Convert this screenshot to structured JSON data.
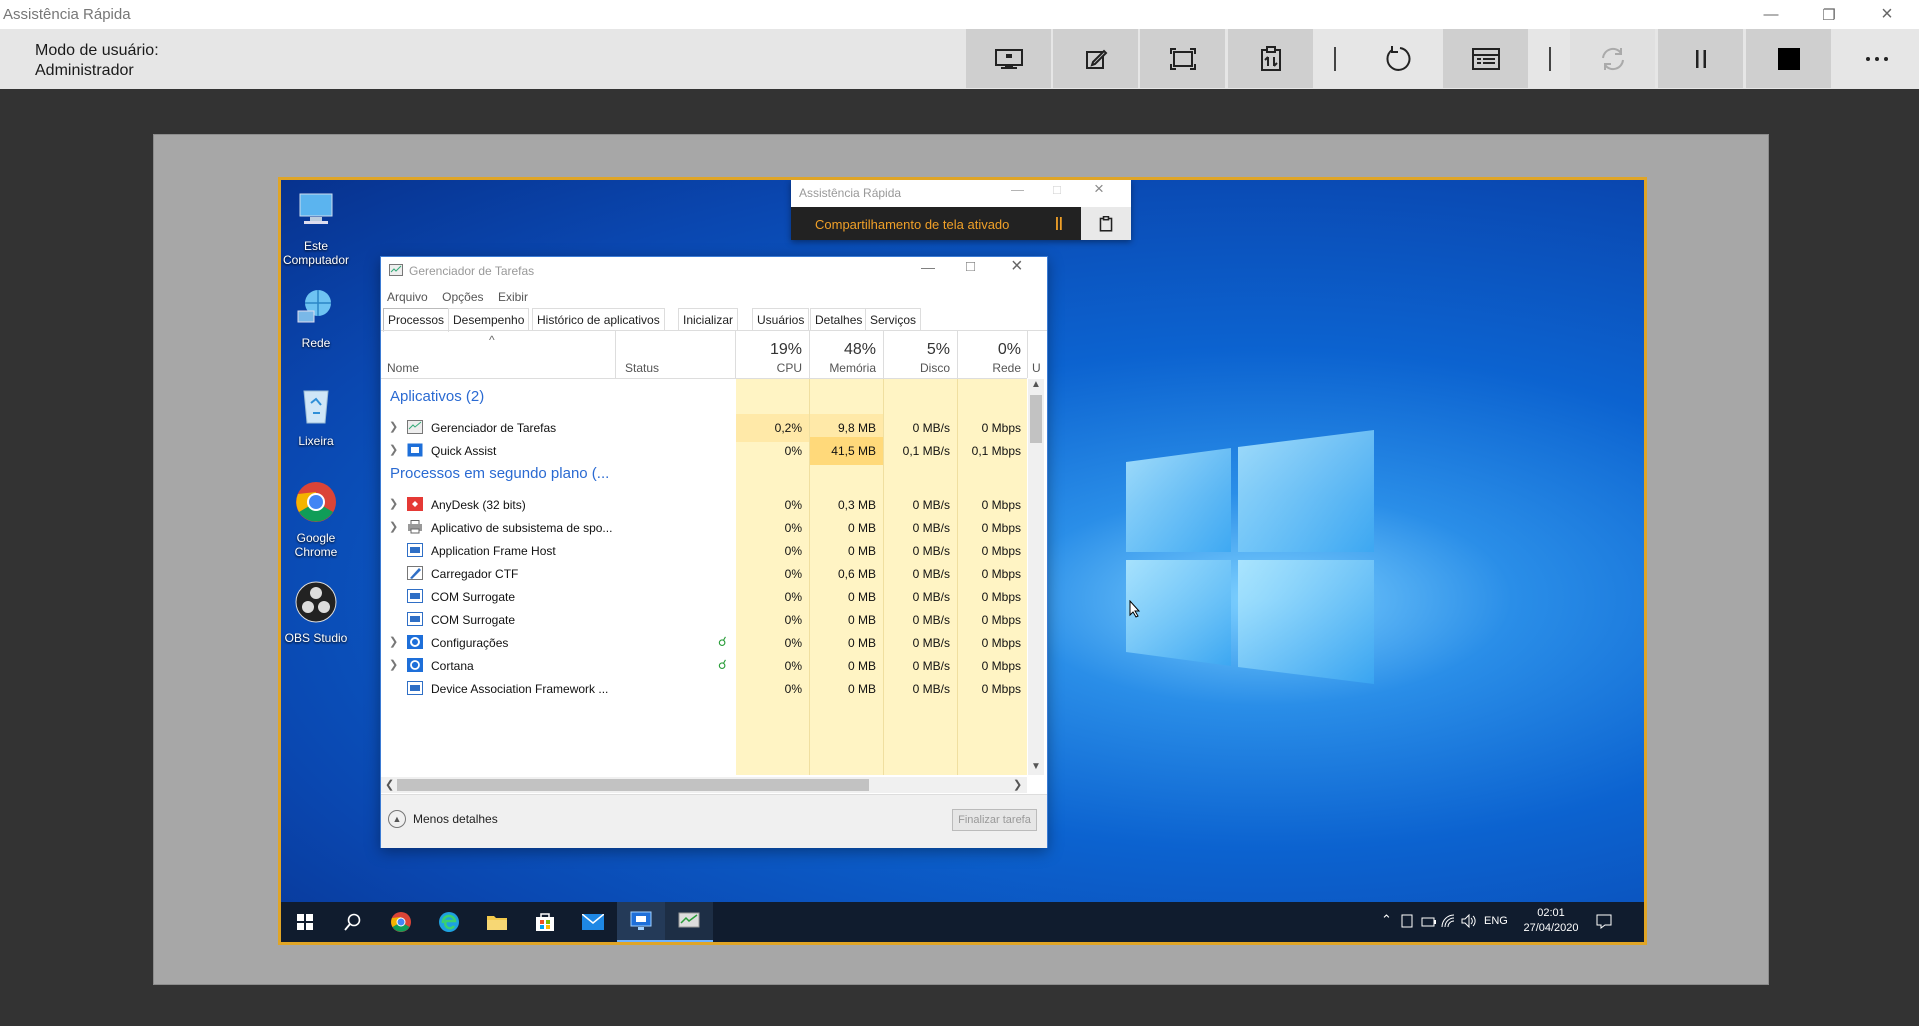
{
  "window": {
    "title": "Assistência Rápida",
    "controls": [
      "minimize-icon",
      "restore-icon",
      "close-icon"
    ]
  },
  "toolbar": {
    "mode_label": "Modo de usuário:",
    "mode_value": "Administrador",
    "buttons": [
      "select-monitor-icon",
      "annotate-icon",
      "actual-size-icon",
      "toggle-instruction-channel-icon",
      "restart-icon",
      "task-manager-icon",
      "reconnect-icon",
      "pause-icon",
      "end-icon",
      "more-icon"
    ]
  },
  "desktop": {
    "icons": [
      {
        "label": "Este Computador"
      },
      {
        "label": "Rede"
      },
      {
        "label": "Lixeira"
      },
      {
        "label": "Google Chrome"
      },
      {
        "label": "OBS Studio"
      }
    ]
  },
  "qa_window": {
    "title": "Assistência Rápida",
    "status": "Compartilhamento de tela ativado"
  },
  "task_manager": {
    "title": "Gerenciador de Tarefas",
    "menu": [
      "Arquivo",
      "Opções",
      "Exibir"
    ],
    "tabs": [
      "Processos",
      "Desempenho",
      "Histórico de aplicativos",
      "Inicializar",
      "Usuários",
      "Detalhes",
      "Serviços"
    ],
    "columns": {
      "name": "Nome",
      "status": "Status",
      "cpu_pct": "19%",
      "cpu": "CPU",
      "mem_pct": "48%",
      "mem": "Memória",
      "disk_pct": "5%",
      "disk": "Disco",
      "net_pct": "0%",
      "net": "Rede",
      "extra": "U"
    },
    "groups": {
      "apps": "Aplicativos (2)",
      "background": "Processos em segundo plano (..."
    },
    "apps": [
      {
        "name": "Gerenciador de Tarefas",
        "cpu": "0,2%",
        "mem": "9,8 MB",
        "disk": "0 MB/s",
        "net": "0 Mbps"
      },
      {
        "name": "Quick Assist",
        "cpu": "0%",
        "mem": "41,5 MB",
        "disk": "0,1 MB/s",
        "net": "0,1 Mbps"
      }
    ],
    "background": [
      {
        "name": "AnyDesk (32 bits)",
        "cpu": "0%",
        "mem": "0,3 MB",
        "disk": "0 MB/s",
        "net": "0 Mbps"
      },
      {
        "name": "Aplicativo de subsistema de spo...",
        "cpu": "0%",
        "mem": "0 MB",
        "disk": "0 MB/s",
        "net": "0 Mbps"
      },
      {
        "name": "Application Frame Host",
        "cpu": "0%",
        "mem": "0 MB",
        "disk": "0 MB/s",
        "net": "0 Mbps"
      },
      {
        "name": "Carregador CTF",
        "cpu": "0%",
        "mem": "0,6 MB",
        "disk": "0 MB/s",
        "net": "0 Mbps"
      },
      {
        "name": "COM Surrogate",
        "cpu": "0%",
        "mem": "0 MB",
        "disk": "0 MB/s",
        "net": "0 Mbps"
      },
      {
        "name": "COM Surrogate",
        "cpu": "0%",
        "mem": "0 MB",
        "disk": "0 MB/s",
        "net": "0 Mbps"
      },
      {
        "name": "Configurações",
        "cpu": "0%",
        "mem": "0 MB",
        "disk": "0 MB/s",
        "net": "0 Mbps"
      },
      {
        "name": "Cortana",
        "cpu": "0%",
        "mem": "0 MB",
        "disk": "0 MB/s",
        "net": "0 Mbps"
      },
      {
        "name": "Device Association Framework ...",
        "cpu": "0%",
        "mem": "0 MB",
        "disk": "0 MB/s",
        "net": "0 Mbps"
      }
    ],
    "footer": {
      "less_details": "Menos detalhes",
      "end_task": "Finalizar tarefa"
    }
  },
  "taskbar": {
    "lang": "ENG",
    "time": "02:01",
    "date": "27/04/2020"
  },
  "colors": {
    "accent_border": "#e0a526",
    "group_text": "#2a6ad2",
    "highlight_cell": "#fff4c4"
  }
}
